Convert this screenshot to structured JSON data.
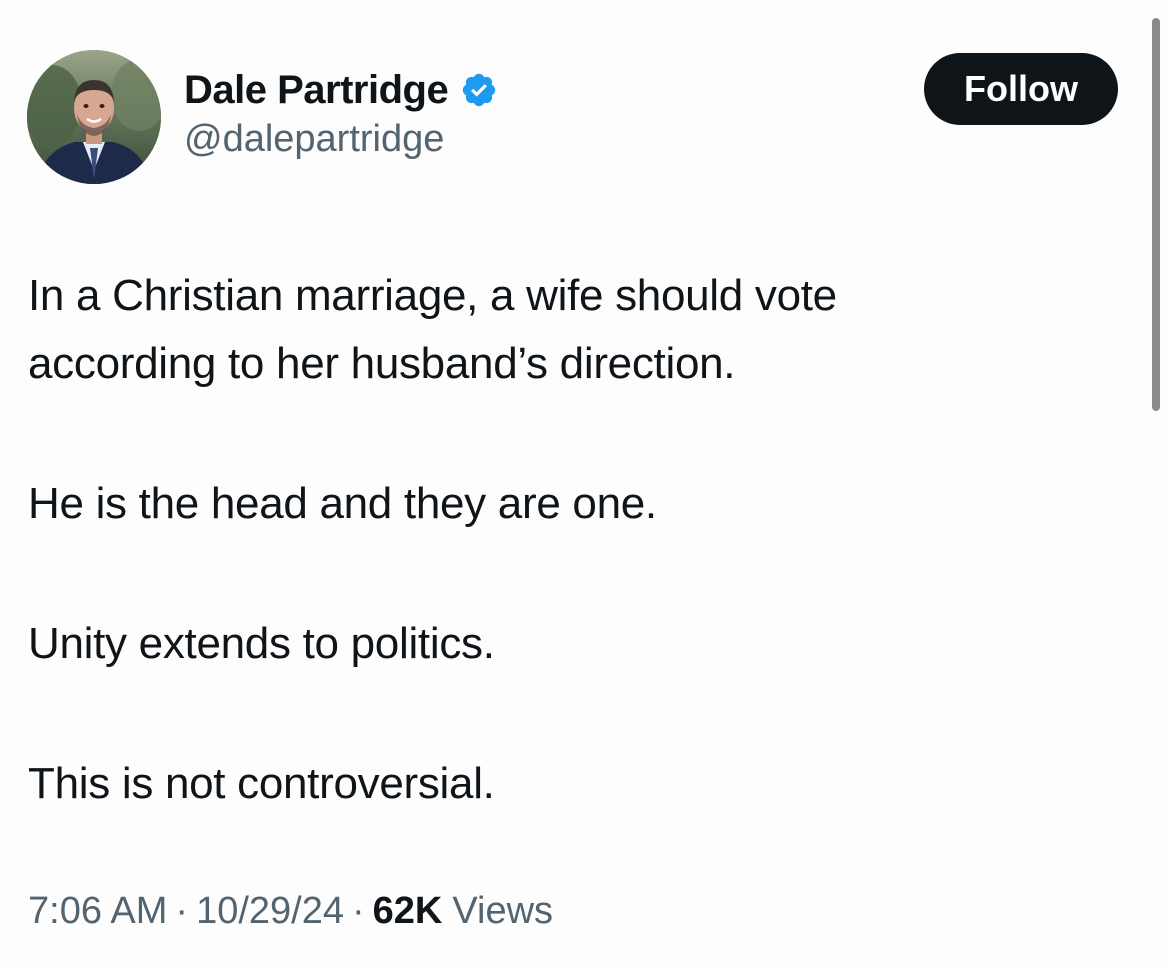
{
  "author": {
    "name": "Dale Partridge",
    "handle": "@dalepartridge",
    "avatar_icon": "profile-photo",
    "verified_icon": "verified-badge-icon",
    "verified_color": "#1d9bf0"
  },
  "follow_button": {
    "label": "Follow",
    "background": "#0f1419",
    "text_color": "#ffffff"
  },
  "tweet": {
    "paragraphs": [
      {
        "lines": [
          "In a Christian marriage, a wife should vote",
          "according to her husband’s direction."
        ]
      },
      {
        "lines": [
          "He is the head and they are one."
        ]
      },
      {
        "lines": [
          "Unity extends to politics."
        ]
      },
      {
        "lines": [
          "This is not controversial."
        ]
      }
    ],
    "time": "7:06 AM",
    "separator": "·",
    "date": "10/29/24",
    "views_count": "62K",
    "views_label": "Views"
  }
}
